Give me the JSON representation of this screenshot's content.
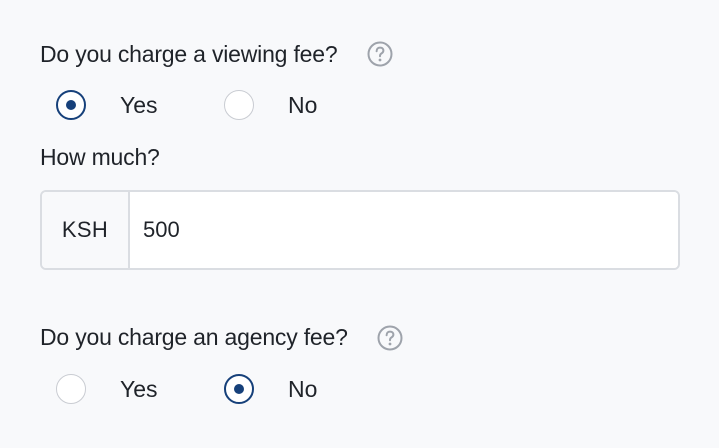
{
  "viewing_fee": {
    "question": "Do you charge a viewing fee?",
    "help_icon": "question-circle-icon",
    "options": [
      {
        "label": "Yes",
        "checked": true
      },
      {
        "label": "No",
        "checked": false
      }
    ],
    "amount_label": "How much?",
    "currency": "KSH",
    "amount_value": "500"
  },
  "agency_fee": {
    "question": "Do you charge an agency fee?",
    "help_icon": "question-circle-icon",
    "options": [
      {
        "label": "Yes",
        "checked": false
      },
      {
        "label": "No",
        "checked": true
      }
    ]
  },
  "colors": {
    "accent": "#16407a",
    "text": "#1f2329",
    "border": "#dadde2",
    "icon": "#9ea3ab",
    "background": "#f8f9fb"
  }
}
